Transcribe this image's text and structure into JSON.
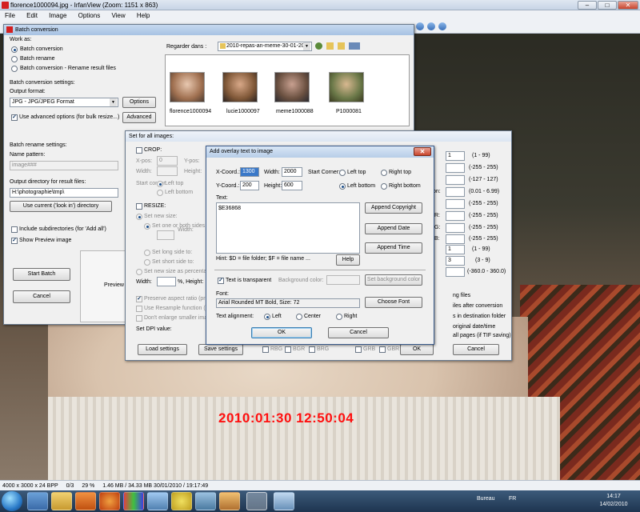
{
  "app": {
    "title": "florence1000094.jpg - IrfanView (Zoom: 1151 x 863)",
    "menu": [
      "File",
      "Edit",
      "Image",
      "Options",
      "View",
      "Help"
    ],
    "win_buttons": [
      "–",
      "□",
      "✕"
    ]
  },
  "photo": {
    "timestamp": "2010:01:30 12:50:04"
  },
  "statusbar": {
    "items": [
      "4000 x 3000 x 24 BPP",
      "0/3",
      "29 %",
      "1.46 MB / 34.33 MB 30/01/2010 / 19:17:49"
    ]
  },
  "taskbar": {
    "lang": "FR",
    "bureau": "Bureau",
    "time": "14:17",
    "date": "14/02/2010"
  },
  "batch": {
    "title": "Batch conversion",
    "work_as": "Work as:",
    "modes": [
      "Batch conversion",
      "Batch rename",
      "Batch conversion - Rename result files"
    ],
    "settings_label": "Batch conversion settings:",
    "output_format_label": "Output format:",
    "output_format_value": "JPG - JPG/JPEG Format",
    "options_button": "Options",
    "advanced_check": "Use advanced options (for bulk resize...)",
    "advanced_button": "Advanced",
    "rename_label": "Batch rename settings:",
    "name_pattern_label": "Name pattern:",
    "name_pattern_value": "image###",
    "output_dir_label": "Output directory for result files:",
    "output_dir_value": "H:\\photographie\\tmp\\",
    "use_current_button": "Use current ('look in') directory",
    "include_subdirs": "Include subdirectories (for 'Add all')",
    "show_preview": "Show Preview image",
    "start_batch": "Start Batch",
    "cancel": "Cancel",
    "preview_label": "Preview",
    "look_in_label": "Regarder dans :",
    "look_in_value": "2010-repas-an-meme-30-01-20",
    "thumbnails": [
      {
        "name": "florence1000094",
        "color": "#d8b8a0"
      },
      {
        "name": "lucie1000097",
        "color": "#c89878"
      },
      {
        "name": "meme1000088",
        "color": "#a08070"
      },
      {
        "name": "P1000081",
        "color": "#8a9070"
      }
    ]
  },
  "setall": {
    "title": "Set for all images:",
    "crop": "CROP:",
    "xpos": "X-pos:",
    "xpos_value": "0",
    "ypos": "Y-pos:",
    "width": "Width:",
    "height": "Height:",
    "start_corner": "Start corner:",
    "left_top": "Left top",
    "left_bottom": "Left bottom",
    "resize": "RESIZE:",
    "set_new_size": "Set new size:",
    "set_one_or_both": "Set one or both sides to:",
    "width2": "Width:",
    "set_long": "Set long side to:",
    "set_short": "Set short side to:",
    "set_percent": "Set new size as percentage of original:",
    "width_pct": "Width:",
    "pct_height": "%, Height:",
    "preserve": "Preserve aspect ratio (proportional)",
    "resample": "Use Resample function (better quality)",
    "dont_enlarge": "Don't enlarge smaller images",
    "set_dpi": "Set DPI value:",
    "load_settings": "Load settings",
    "save_settings": "Save settings",
    "channels": [
      "RBG",
      "BGR",
      "BRG",
      "GRB",
      "GBR"
    ],
    "ok": "OK",
    "cancel": "Cancel",
    "right_values": [
      "1",
      "",
      "",
      "",
      "",
      "",
      "",
      "1",
      "3",
      ""
    ],
    "right_ranges": [
      "(1 - 99)",
      "(-255 - 255)",
      "(-127 - 127)",
      "(0.01 - 6.99)",
      "(-255 - 255)",
      "(-255 - 255)",
      "(-255 - 255)",
      "(1 - 99)",
      "(3 - 9)",
      "(-360.0 - 360.0)"
    ],
    "right_labels": [
      "on:",
      "R:",
      "G:",
      "B:"
    ],
    "right_options": [
      "ng files",
      "iles after conversion",
      "s in destination folder",
      "original date/time",
      "all pages (if TIF saving)"
    ]
  },
  "overlay": {
    "title": "Add overlay text to image",
    "xcoord_label": "X-Coord.:",
    "xcoord_value": "1300",
    "width_label": "Width:",
    "width_value": "2000",
    "start_corner": "Start Corner:",
    "left_top": "Left top",
    "right_top": "Right top",
    "ycoord_label": "Y-Coord.:",
    "ycoord_value": "200",
    "height_label": "Height:",
    "height_value": "600",
    "left_bottom": "Left bottom",
    "right_bottom": "Right bottom",
    "text_label": "Text:",
    "text_value": "$E36868",
    "append_copyright": "Append Copyright",
    "append_date": "Append Date",
    "append_time": "Append Time",
    "hint": "Hint: $D = file folder; $F = file name ...",
    "help": "Help",
    "transparent": "Text is transparent",
    "bg_color_label": "Background color:",
    "set_bg_color": "Set background color",
    "font_label": "Font:",
    "font_value": "Arial Rounded MT Bold, Size: 72",
    "choose_font": "Choose Font",
    "alignment_label": "Text alignment:",
    "align_left": "Left",
    "align_center": "Center",
    "align_right": "Right",
    "ok": "OK",
    "cancel": "Cancel"
  }
}
